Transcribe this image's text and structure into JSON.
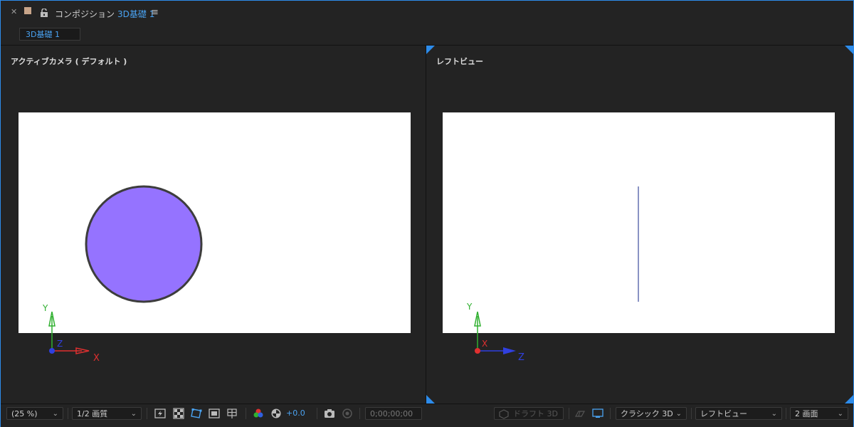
{
  "panel": {
    "title_prefix": "コンポジション",
    "comp_name": "3D基礎 1",
    "tab_label": "3D基礎 1"
  },
  "icons": {
    "close": "close-icon",
    "color_swatch": "color-swatch",
    "lock": "lock-icon",
    "menu": "hamburger-menu-icon"
  },
  "colors": {
    "accent": "#2d8ceb",
    "accent_text": "#4aa3f2",
    "swatch": "#c8a58a",
    "circle_fill": "#9573ff",
    "circle_stroke": "#3d3d3d",
    "axis_x": "#e03030",
    "axis_y": "#30b030",
    "axis_z": "#3040e0"
  },
  "views": {
    "left": {
      "label": "アクティブカメラ ( デフォルト )",
      "axis_x": "X",
      "axis_y": "Y",
      "axis_z": "Z"
    },
    "right": {
      "label": "レフトビュー",
      "axis_x": "X",
      "axis_y": "Y",
      "axis_z": "Z"
    }
  },
  "status": {
    "zoom": "(25 %)",
    "resolution": "1/2 画質",
    "exposure": "+0.0",
    "timecode": "0;00;00;00",
    "draft3d": "ドラフト 3D",
    "renderer": "クラシック 3D",
    "view": "レフトビュー",
    "layout": "2 画面"
  }
}
